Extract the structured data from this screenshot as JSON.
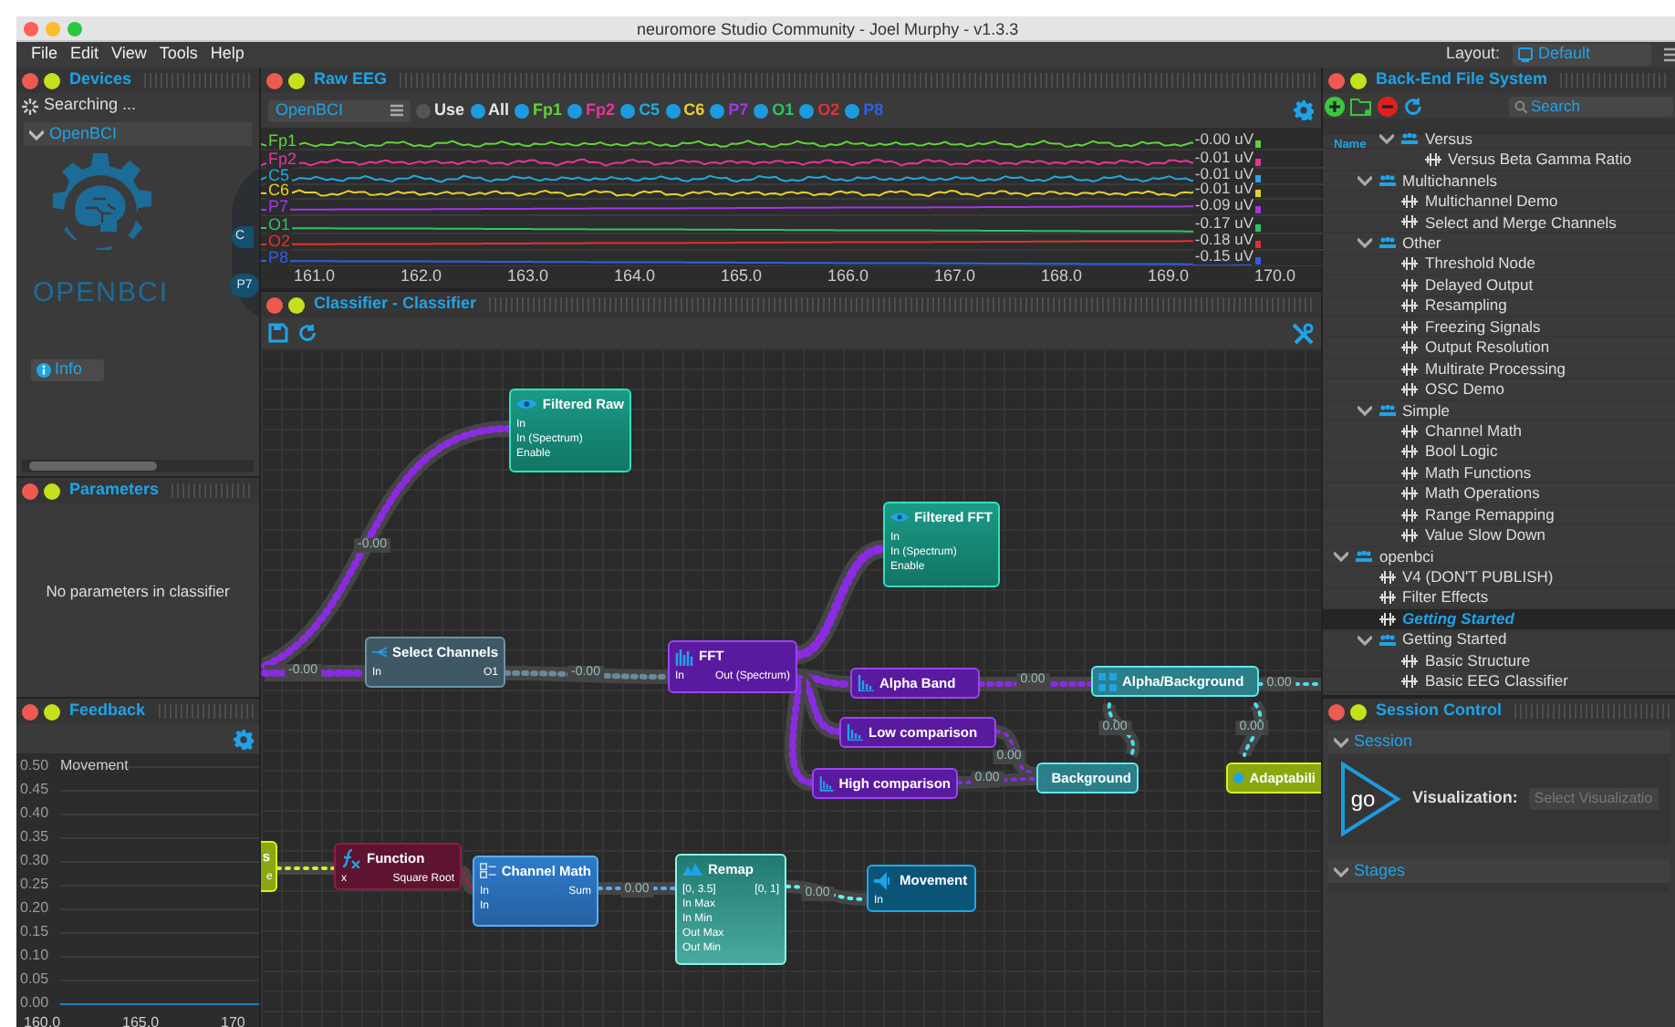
{
  "window": {
    "title": "neuromore Studio Community - Joel Murphy - v1.3.3"
  },
  "menu": [
    "File",
    "Edit",
    "View",
    "Tools",
    "Help"
  ],
  "layout": {
    "label": "Layout:",
    "value": "Default"
  },
  "devices": {
    "title": "Devices",
    "status": "Searching ...",
    "device": "OpenBCI",
    "logo_text": "OPENBCI",
    "head_labels": [
      "C",
      "P7"
    ],
    "info_button": "Info"
  },
  "parameters": {
    "title": "Parameters",
    "message": "No parameters in classifier"
  },
  "feedback": {
    "title": "Feedback",
    "series": "Movement",
    "yticks": [
      "0.50",
      "0.45",
      "0.40",
      "0.35",
      "0.30",
      "0.25",
      "0.20",
      "0.15",
      "0.10",
      "0.05",
      "0.00"
    ],
    "xticks": [
      "160.0",
      "165.0",
      "170"
    ]
  },
  "raw_eeg": {
    "title": "Raw EEG",
    "device": "OpenBCI",
    "toggles": [
      {
        "label": "Use",
        "on": false
      },
      {
        "label": "All",
        "on": true
      },
      {
        "label": "Fp1",
        "on": true,
        "color": "#62d13a"
      },
      {
        "label": "Fp2",
        "on": true,
        "color": "#e8339c"
      },
      {
        "label": "C5",
        "on": true,
        "color": "#23a9e1"
      },
      {
        "label": "C6",
        "on": true,
        "color": "#e5d22b"
      },
      {
        "label": "P7",
        "on": true,
        "color": "#a535e6"
      },
      {
        "label": "O1",
        "on": true,
        "color": "#2ec462"
      },
      {
        "label": "O2",
        "on": true,
        "color": "#e3312f"
      },
      {
        "label": "P8",
        "on": true,
        "color": "#2f5fe6"
      }
    ],
    "channels": [
      {
        "name": "Fp1",
        "color": "#62d13a",
        "reading": "-0.00 uV"
      },
      {
        "name": "Fp2",
        "color": "#e8339c",
        "reading": "-0.01 uV"
      },
      {
        "name": "C5",
        "color": "#23a9e1",
        "reading": "-0.01 uV"
      },
      {
        "name": "C6",
        "color": "#e5d22b",
        "reading": "-0.01 uV"
      },
      {
        "name": "P7",
        "color": "#a535e6",
        "reading": "-0.09 uV"
      },
      {
        "name": "O1",
        "color": "#2ec462",
        "reading": "-0.17 uV"
      },
      {
        "name": "O2",
        "color": "#e3312f",
        "reading": "-0.18 uV"
      },
      {
        "name": "P8",
        "color": "#2f5fe6",
        "reading": "-0.15 uV"
      }
    ],
    "xticks": [
      "161.0",
      "162.0",
      "163.0",
      "164.0",
      "165.0",
      "166.0",
      "167.0",
      "168.0",
      "169.0",
      "170.0"
    ]
  },
  "classifier": {
    "title": "Classifier - Classifier",
    "nodes": [
      {
        "kind": "view",
        "title": "Filtered Raw",
        "inputs": [
          "In",
          "In (Spectrum)",
          "Enable"
        ]
      },
      {
        "kind": "view",
        "title": "Filtered FFT",
        "inputs": [
          "In",
          "In (Spectrum)",
          "Enable"
        ]
      },
      {
        "kind": "select",
        "title": "Select Channels",
        "inputs": [
          "In"
        ],
        "outputs": [
          "O1"
        ]
      },
      {
        "kind": "spectrum",
        "title": "FFT",
        "inputs": [
          "In"
        ],
        "outputs": [
          "Out (Spectrum)"
        ]
      },
      {
        "kind": "band",
        "title": "Alpha Band"
      },
      {
        "kind": "band",
        "title": "Low comparison"
      },
      {
        "kind": "band",
        "title": "High comparison"
      },
      {
        "kind": "ratio",
        "title": "Alpha/Background"
      },
      {
        "kind": "ratio",
        "title": "Background"
      },
      {
        "kind": "adapt",
        "title": "Adaptabili"
      },
      {
        "kind": "partial",
        "title": "s",
        "outputs": [
          "e"
        ]
      },
      {
        "kind": "function",
        "title": "Function",
        "inputs": [
          "x"
        ],
        "outputs": [
          "Square Root"
        ]
      },
      {
        "kind": "math",
        "title": "Channel Math",
        "inputs": [
          "In",
          "In"
        ],
        "outputs": [
          "Sum"
        ]
      },
      {
        "kind": "remap",
        "title": "Remap",
        "inputs": [
          "[0, 3.5]",
          "In Max",
          "In Min",
          "Out Max",
          "Out Min"
        ],
        "outputs": [
          "[0, 1]"
        ]
      },
      {
        "kind": "output",
        "title": "Movement",
        "inputs": [
          "In"
        ]
      }
    ],
    "edge_labels": [
      "-0.00",
      "-0.00",
      "-0.00",
      "0.00",
      "0.00",
      "0.00",
      "0.00",
      "0.00",
      "0.00",
      "0.00",
      "0.00"
    ]
  },
  "file_system": {
    "title": "Back-End File System",
    "search_placeholder": "Search",
    "column": "Name",
    "tree": [
      {
        "children": [
          {
            "children": [
              {
                "kind": "folder",
                "label": "Versus",
                "expanded": true,
                "children": [
                  {
                    "kind": "file",
                    "label": "Versus Beta Gamma Ratio",
                    "selected": false
                  }
                ]
              }
            ]
          },
          {
            "kind": "folder",
            "label": "Multichannels",
            "expanded": true,
            "children": [
              {
                "kind": "file",
                "label": "Multichannel Demo",
                "selected": false
              },
              {
                "kind": "file",
                "label": "Select and Merge Channels",
                "selected": false
              }
            ]
          },
          {
            "kind": "folder",
            "label": "Other",
            "expanded": true,
            "children": [
              {
                "kind": "file",
                "label": "Threshold Node",
                "selected": false
              },
              {
                "kind": "file",
                "label": "Delayed Output",
                "selected": false
              },
              {
                "kind": "file",
                "label": "Resampling",
                "selected": false
              },
              {
                "kind": "file",
                "label": "Freezing Signals",
                "selected": false
              },
              {
                "kind": "file",
                "label": "Output Resolution",
                "selected": false
              },
              {
                "kind": "file",
                "label": "Multirate Processing",
                "selected": false
              },
              {
                "kind": "file",
                "label": "OSC Demo",
                "selected": false
              }
            ]
          },
          {
            "kind": "folder",
            "label": "Simple",
            "expanded": true,
            "children": [
              {
                "kind": "file",
                "label": "Channel Math",
                "selected": false
              },
              {
                "kind": "file",
                "label": "Bool Logic",
                "selected": false
              },
              {
                "kind": "file",
                "label": "Math Functions",
                "selected": false
              },
              {
                "kind": "file",
                "label": "Math Operations",
                "selected": false
              },
              {
                "kind": "file",
                "label": "Range Remapping",
                "selected": false
              },
              {
                "kind": "file",
                "label": "Value Slow Down",
                "selected": false
              }
            ]
          }
        ]
      },
      {
        "kind": "folder",
        "label": "openbci",
        "expanded": true,
        "children": [
          {
            "kind": "file",
            "label": "V4 (DON'T PUBLISH)",
            "selected": false
          },
          {
            "kind": "file",
            "label": "Filter Effects",
            "selected": false
          },
          {
            "kind": "file",
            "label": "Getting Started",
            "selected": true
          },
          {
            "kind": "folder",
            "label": "Getting Started",
            "expanded": true,
            "children": [
              {
                "kind": "file",
                "label": "Basic Structure",
                "selected": false
              },
              {
                "kind": "file",
                "label": "Basic EEG Classifier",
                "selected": false
              }
            ]
          }
        ]
      }
    ]
  },
  "session": {
    "title": "Session Control",
    "section": "Session",
    "go_button": "go",
    "visualization_label": "Visualization:",
    "visualization_placeholder": "Select Visualizatio",
    "stages": "Stages"
  }
}
